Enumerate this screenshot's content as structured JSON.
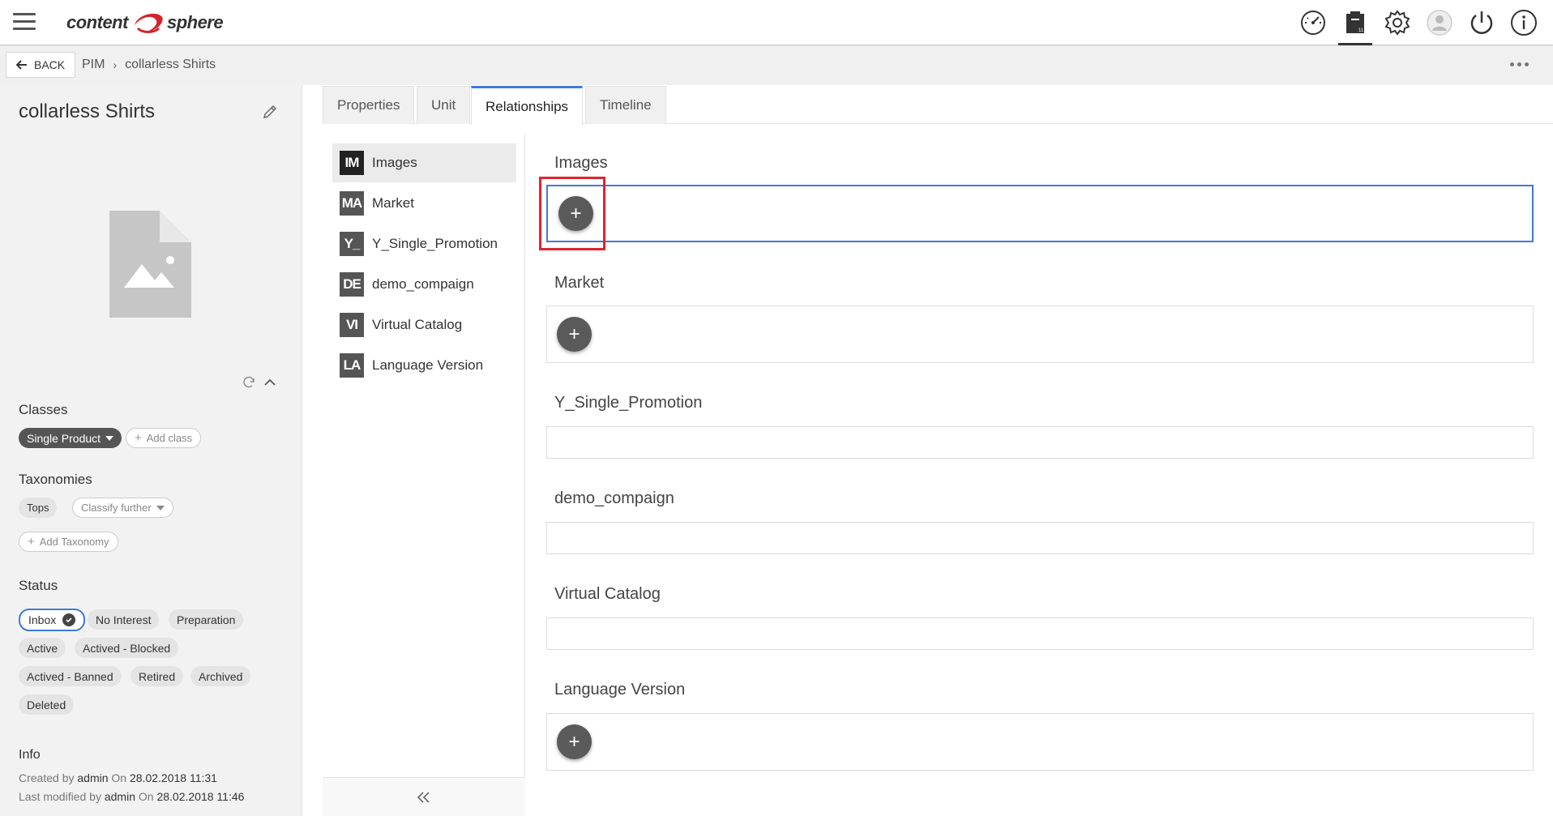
{
  "app": {
    "logo_left": "content",
    "logo_right": "sphere"
  },
  "topbar": {
    "icons": [
      "dashboard-icon",
      "pim-icon",
      "settings-icon",
      "user-icon",
      "power-icon",
      "info-icon"
    ],
    "active_icon": "pim-icon"
  },
  "breadcrumb": {
    "back_label": "BACK",
    "items": [
      "PIM",
      "collarless Shirts"
    ]
  },
  "product": {
    "title": "collarless Shirts",
    "classes_label": "Classes",
    "class_chip": "Single Product",
    "add_class": "Add class",
    "taxonomies_label": "Taxonomies",
    "taxonomy_chip": "Tops",
    "classify_further": "Classify further",
    "add_taxonomy": "Add Taxonomy",
    "status_label": "Status",
    "statuses": [
      "Inbox",
      "No Interest",
      "Preparation",
      "Active",
      "Actived - Blocked",
      "Actived - Banned",
      "Retired",
      "Archived",
      "Deleted"
    ],
    "selected_status": "Inbox",
    "info_label": "Info",
    "created_prefix": "Created by",
    "created_by": "admin",
    "created_on_prefix": "On",
    "created_on": "28.02.2018 11:31",
    "modified_prefix": "Last modified by",
    "modified_by": "admin",
    "modified_on_prefix": "On",
    "modified_on": "28.02.2018 11:46"
  },
  "tabs": [
    {
      "label": "Properties"
    },
    {
      "label": "Unit"
    },
    {
      "label": "Relationships"
    },
    {
      "label": "Timeline"
    }
  ],
  "active_tab": "Relationships",
  "relationships": [
    {
      "badge": "IM",
      "label": "Images"
    },
    {
      "badge": "MA",
      "label": "Market"
    },
    {
      "badge": "Y_",
      "label": "Y_Single_Promotion"
    },
    {
      "badge": "DE",
      "label": "demo_compaign"
    },
    {
      "badge": "VI",
      "label": "Virtual Catalog"
    },
    {
      "badge": "LA",
      "label": "Language Version"
    }
  ],
  "groups": [
    {
      "title": "Images",
      "has_add": true
    },
    {
      "title": "Market",
      "has_add": true
    },
    {
      "title": "Y_Single_Promotion",
      "has_add": false
    },
    {
      "title": "demo_compaign",
      "has_add": false
    },
    {
      "title": "Virtual Catalog",
      "has_add": false
    },
    {
      "title": "Language Version",
      "has_add": true
    }
  ],
  "colors": {
    "accent": "#3f7ad8",
    "highlight": "#e0242b",
    "brand_red": "#d4232a"
  }
}
